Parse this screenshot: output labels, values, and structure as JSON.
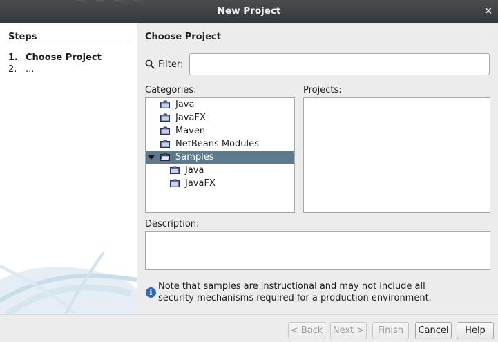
{
  "window": {
    "title": "New Project",
    "close_glyph": "✕"
  },
  "steps": {
    "heading": "Steps",
    "items": [
      {
        "num": "1.",
        "label": "Choose Project",
        "active": true
      },
      {
        "num": "2.",
        "label": "...",
        "active": false
      }
    ]
  },
  "main": {
    "heading": "Choose Project",
    "filter": {
      "label": "Filter:",
      "value": "",
      "placeholder": ""
    },
    "categories_label": "Categories:",
    "projects_label": "Projects:",
    "description_label": "Description:",
    "categories": [
      {
        "label": "Java",
        "level": 0,
        "expanded": null,
        "selected": false
      },
      {
        "label": "JavaFX",
        "level": 0,
        "expanded": null,
        "selected": false
      },
      {
        "label": "Maven",
        "level": 0,
        "expanded": null,
        "selected": false
      },
      {
        "label": "NetBeans Modules",
        "level": 0,
        "expanded": null,
        "selected": false
      },
      {
        "label": "Samples",
        "level": 0,
        "expanded": true,
        "selected": true
      },
      {
        "label": "Java",
        "level": 1,
        "expanded": null,
        "selected": false
      },
      {
        "label": "JavaFX",
        "level": 1,
        "expanded": null,
        "selected": false
      }
    ],
    "projects": [],
    "description": "",
    "note_line1": "Note that samples are instructional and may not include all",
    "note_line2": "security mechanisms required for a production environment."
  },
  "buttons": {
    "back": "< Back",
    "next": "Next >",
    "finish": "Finish",
    "cancel": "Cancel",
    "help": "Help"
  },
  "colors": {
    "titlebar": "#3a3e41",
    "selection": "#5f7a8c",
    "info_icon": "#2f6bb4"
  }
}
